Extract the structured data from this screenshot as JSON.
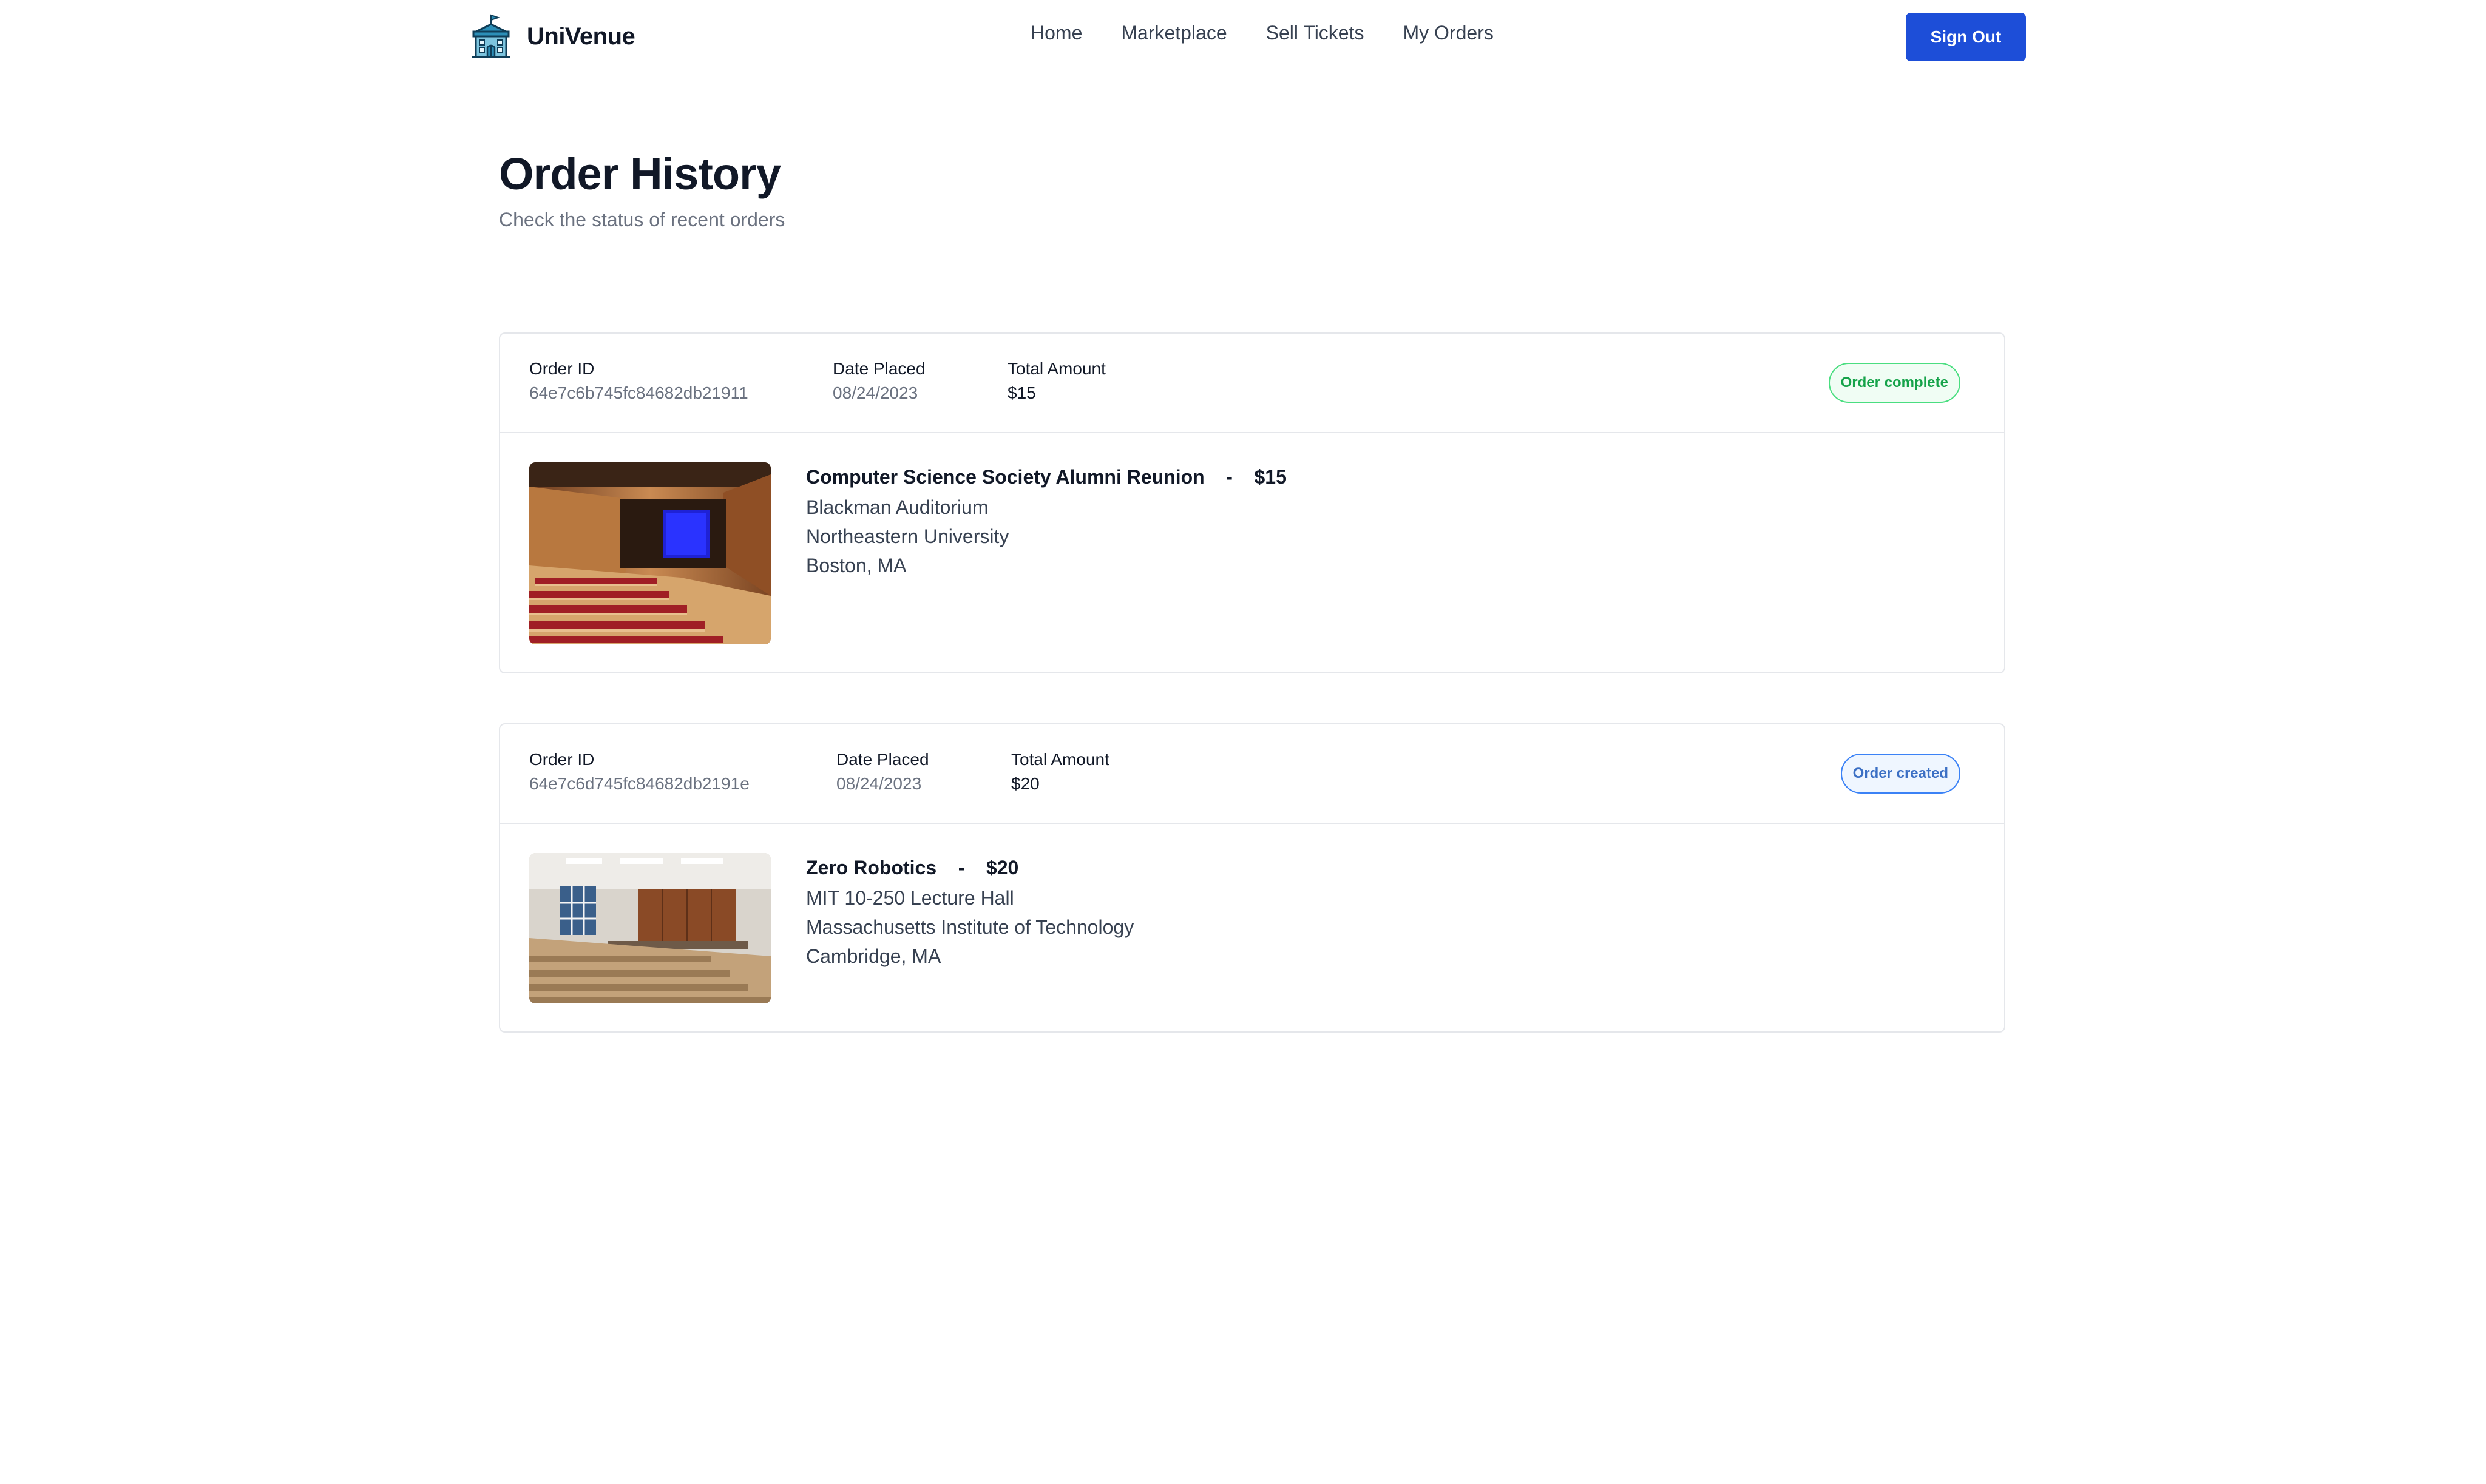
{
  "navbar": {
    "brand_name": "UniVenue",
    "brand_icon": "school-building-icon",
    "links": [
      "Home",
      "Marketplace",
      "Sell Tickets",
      "My Orders"
    ],
    "sign_out_label": "Sign Out",
    "accent_color": "#1d4ed8"
  },
  "header": {
    "title": "Order History",
    "subtitle": "Check the status of recent orders"
  },
  "orders": [
    {
      "order_id_label": "Order ID",
      "order_id": "64e7c6b745fc84682db21911",
      "date_label": "Date Placed",
      "date": "08/24/2023",
      "total_label": "Total Amount",
      "total": "$15",
      "status": "Order complete",
      "status_color": "#16a34a",
      "event_name": "Computer Science Society Alumni Reunion",
      "separator": "-",
      "price": "$15",
      "venue": "Blackman Auditorium",
      "university": "Northeastern University",
      "location": "Boston, MA"
    },
    {
      "order_id_label": "Order ID",
      "order_id": "64e7c6d745fc84682db2191e",
      "date_label": "Date Placed",
      "date": "08/24/2023",
      "total_label": "Total Amount",
      "total": "$20",
      "status": "Order created",
      "status_color": "#3b6fc4",
      "event_name": "Zero Robotics",
      "separator": "-",
      "price": "$20",
      "venue": "MIT 10-250 Lecture Hall",
      "university": "Massachusetts Institute of Technology",
      "location": "Cambridge, MA"
    }
  ]
}
